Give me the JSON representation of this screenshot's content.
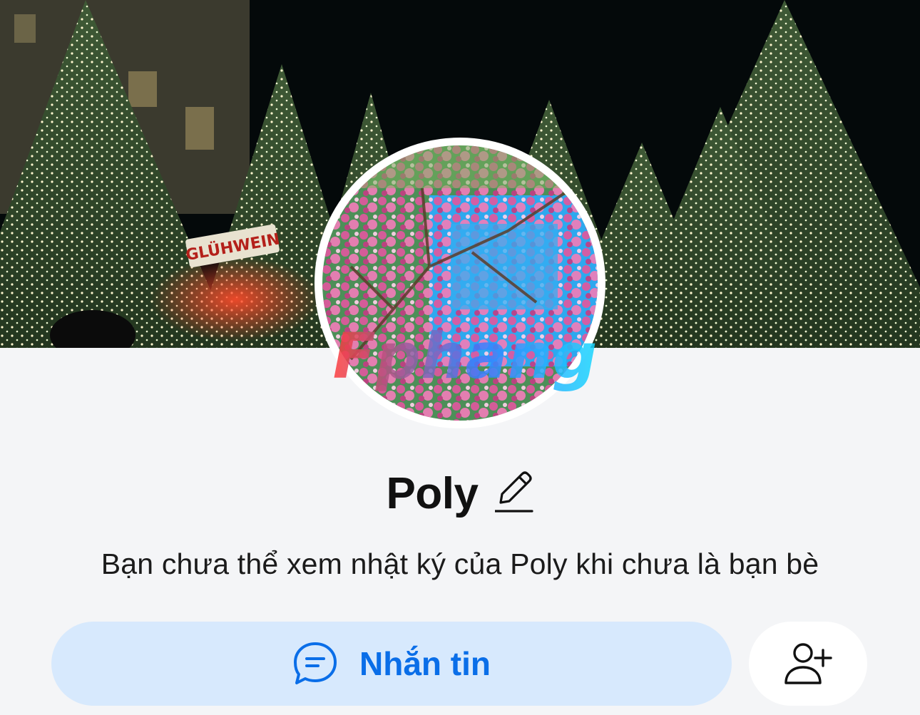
{
  "profile": {
    "name": "Poly",
    "info_text": "Bạn chưa thể xem nhật ký của Poly khi chưa là bạn bè"
  },
  "cover": {
    "sign_text": "GLÜHWEIN"
  },
  "avatar": {
    "watermark_text": "Fphang"
  },
  "actions": {
    "message_label": "Nhắn tin"
  },
  "icons": {
    "edit": "pencil-icon",
    "message": "chat-bubble-icon",
    "add_friend": "add-friend-icon"
  },
  "colors": {
    "background": "#f4f5f7",
    "accent": "#0a6ee8",
    "message_button_bg": "#d7e9fd",
    "text": "#111111"
  }
}
